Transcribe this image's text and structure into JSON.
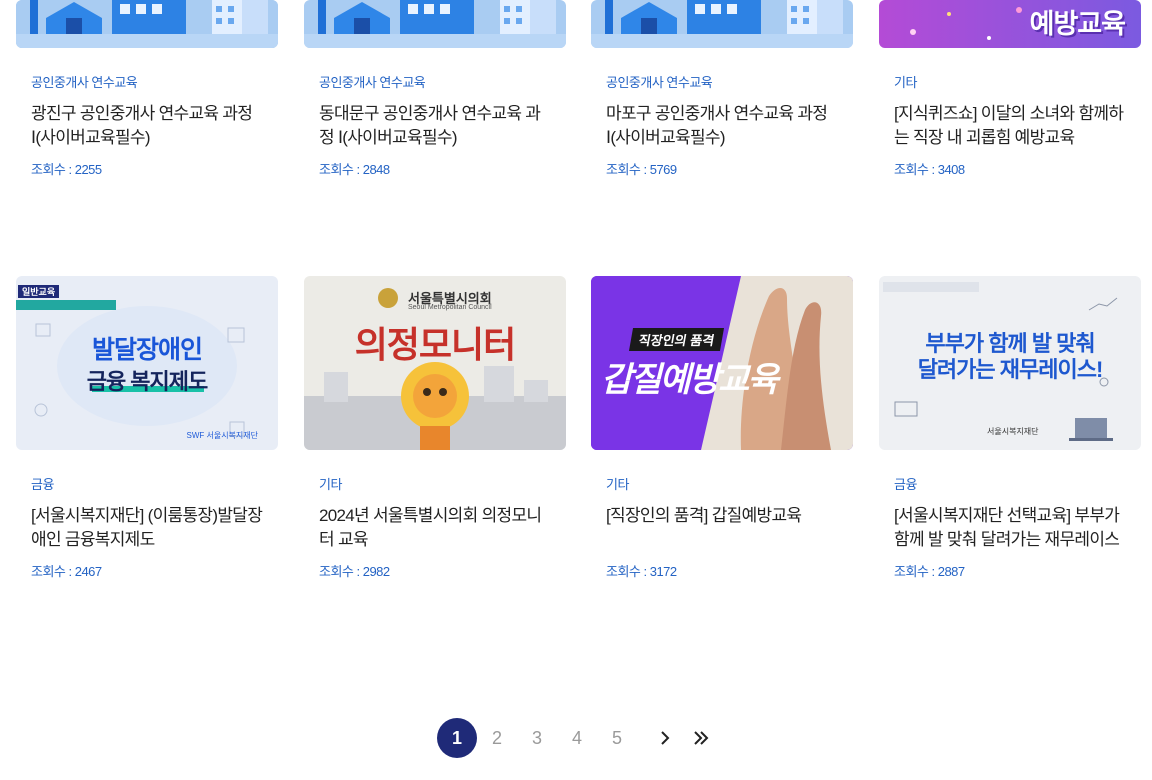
{
  "cards": [
    {
      "category": "공인중개사 연수교육",
      "title": "광진구 공인중개사 연수교육 과정 Ⅰ(사이버교육필수)",
      "views_label": "조회수 : ",
      "views": "2255"
    },
    {
      "category": "공인중개사 연수교육",
      "title": "동대문구 공인중개사 연수교육 과정 Ⅰ(사이버교육필수)",
      "views_label": "조회수 : ",
      "views": "2848"
    },
    {
      "category": "공인중개사 연수교육",
      "title": "마포구 공인중개사 연수교육 과정 Ⅰ(사이버교육필수)",
      "views_label": "조회수 : ",
      "views": "5769"
    },
    {
      "category": "기타",
      "title": "[지식퀴즈쇼] 이달의 소녀와 함께하는 직장 내 괴롭힘 예방교육",
      "views_label": "조회수 : ",
      "views": "3408",
      "thumb_text": "예방교육"
    },
    {
      "category": "금융",
      "title": "[서울시복지재단] (이룸통장)발달장애인 금융복지제도",
      "views_label": "조회수 : ",
      "views": "2467",
      "thumb_badge": "일반교육",
      "thumb_line1": "발달장애인",
      "thumb_line2": "금융 복지제도",
      "thumb_logo": "SWF 서울시복지재단"
    },
    {
      "category": "기타",
      "title": "2024년 서울특별시의회 의정모니터 교육",
      "views_label": "조회수 : ",
      "views": "2982",
      "thumb_org": "서울특별시의회",
      "thumb_org_en": "Seoul Metropolitan Council",
      "thumb_main": "의정모니터"
    },
    {
      "category": "기타",
      "title": "[직장인의 품격] 갑질예방교육",
      "views_label": "조회수 : ",
      "views": "3172",
      "thumb_sub": "직장인의 품격",
      "thumb_main": "갑질예방교육"
    },
    {
      "category": "금융",
      "title": "[서울시복지재단 선택교육] 부부가 함께 발 맞춰 달려가는 재무레이스",
      "views_label": "조회수 : ",
      "views": "2887",
      "thumb_line1": "부부가 함께 발 맞춰",
      "thumb_line2": "달려가는 재무레이스!",
      "thumb_logo": "서울시복지재단"
    }
  ],
  "pagination": {
    "pages": [
      "1",
      "2",
      "3",
      "4",
      "5"
    ],
    "current": "1"
  },
  "colors": {
    "accent": "#2463c4",
    "active_page": "#1f2a78"
  }
}
